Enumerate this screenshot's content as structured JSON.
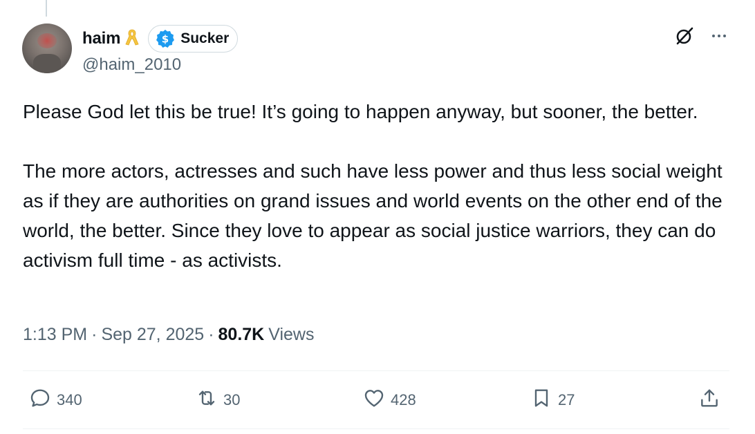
{
  "author": {
    "display_name": "haim",
    "handle": "@haim_2010",
    "badge_label": "Sucker",
    "ribbon_icon": "yellow-ribbon-icon",
    "badge_icon": "dollar-coin-icon"
  },
  "header_icons": [
    "grok-icon",
    "more-icon"
  ],
  "tweet": {
    "paragraph_1": "Please God let this be true! It’s going to happen anyway, but sooner, the better.",
    "paragraph_2": "The more actors, actresses and such have less power and thus less social weight as if they are authorities on grand issues and world events on the other end of the world, the better. Since they love to appear as social justice warriors, they can do activism full time - as activists."
  },
  "meta": {
    "time": "1:13 PM",
    "date": "Sep 27, 2025",
    "separator": "·",
    "views_count": "80.7K",
    "views_label": "Views"
  },
  "actions": {
    "replies": "340",
    "reposts": "30",
    "likes": "428",
    "bookmarks": "27"
  },
  "colors": {
    "text_primary": "#0f1419",
    "text_secondary": "#536471",
    "badge_blue": "#1d9bf0",
    "ribbon_yellow": "#f5c542",
    "border": "#cfd9de"
  }
}
